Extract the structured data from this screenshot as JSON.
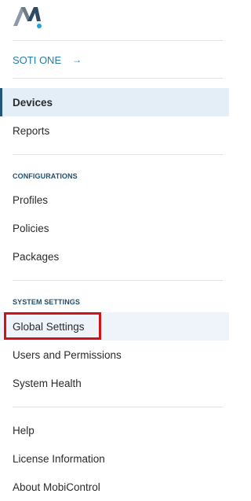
{
  "header": {
    "logo_icon": "mobicontrol-logo-icon",
    "soti_link": "SOTI ONE",
    "soti_arrow_icon": "arrow-right-icon",
    "accent_color": "#1f7fa8"
  },
  "nav": {
    "primary": [
      {
        "label": "Devices",
        "state": "active"
      },
      {
        "label": "Reports"
      }
    ],
    "configurations": {
      "heading": "CONFIGURATIONS",
      "items": [
        {
          "label": "Profiles"
        },
        {
          "label": "Policies"
        },
        {
          "label": "Packages"
        }
      ]
    },
    "system_settings": {
      "heading": "SYSTEM SETTINGS",
      "items": [
        {
          "label": "Global Settings",
          "state": "hover",
          "highlighted": true
        },
        {
          "label": "Users and Permissions"
        },
        {
          "label": "System Health"
        }
      ]
    },
    "footer": [
      {
        "label": "Help"
      },
      {
        "label": "License Information"
      },
      {
        "label": "About MobiControl"
      }
    ]
  },
  "colors": {
    "active_bg": "#e3eef6",
    "active_bar": "#22577a",
    "highlight_box": "#d0121b",
    "section_heading": "#1d4f73"
  }
}
